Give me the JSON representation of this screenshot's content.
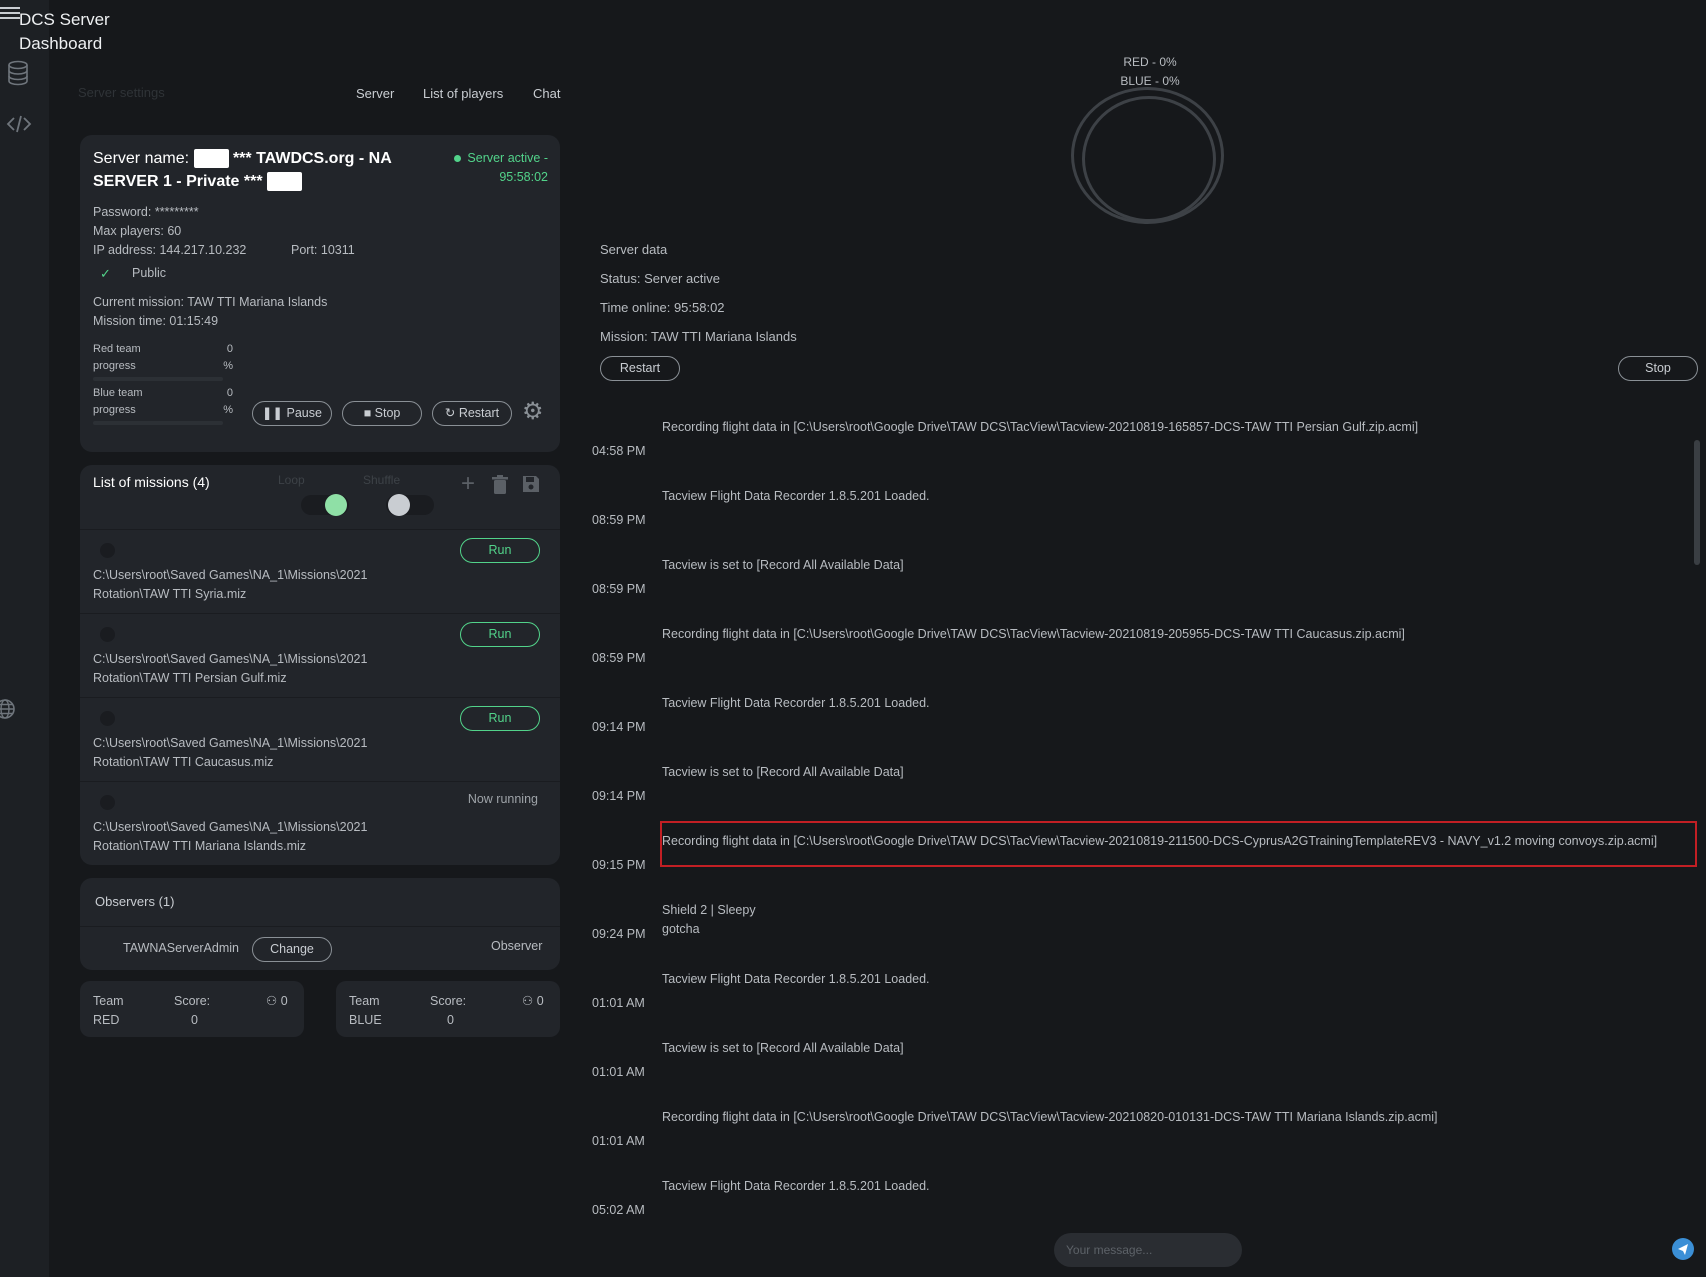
{
  "app": {
    "title": "DCS Server Dashboard"
  },
  "nav": {
    "breadcrumb": "Server settings",
    "links": [
      "Server",
      "List of players",
      "Chat"
    ]
  },
  "server": {
    "name_prefix": "Server name:",
    "name_text": "*** TAWDCS.org - NA SERVER 1 - Private ***",
    "status": "Server active - 95:58:02",
    "password": "Password: *********",
    "max_players": "Max players: 60",
    "ip": "IP address: 144.217.10.232",
    "port": "Port: 10311",
    "public_label": "Public",
    "current_mission": "Current mission: TAW TTI Mariana Islands",
    "mission_time": "Mission time: 01:15:49",
    "red_progress_label": "Red team progress",
    "red_progress_value": "0 %",
    "red_progress_fraction": 0,
    "blue_progress_label": "Blue team progress",
    "blue_progress_value": "0 %",
    "blue_progress_fraction": 0,
    "buttons": {
      "pause": "Pause",
      "stop": "Stop",
      "restart": "Restart"
    }
  },
  "missions": {
    "title": "List of missions (4)",
    "loop_label": "Loop",
    "loop_on": true,
    "shuffle_label": "Shuffle",
    "shuffle_on": false,
    "items": [
      {
        "path": "C:\\Users\\root\\Saved Games\\NA_1\\Missions\\2021 Rotation\\TAW TTI Syria.miz",
        "action": "Run"
      },
      {
        "path": "C:\\Users\\root\\Saved Games\\NA_1\\Missions\\2021 Rotation\\TAW TTI Persian Gulf.miz",
        "action": "Run"
      },
      {
        "path": "C:\\Users\\root\\Saved Games\\NA_1\\Missions\\2021 Rotation\\TAW TTI Caucasus.miz",
        "action": "Run"
      },
      {
        "path": "C:\\Users\\root\\Saved Games\\NA_1\\Missions\\2021 Rotation\\TAW TTI Mariana Islands.miz",
        "action": "Now running"
      }
    ]
  },
  "observers": {
    "title": "Observers (1)",
    "name": "TAWNAServerAdmin",
    "change_label": "Change",
    "role": "Observer"
  },
  "teams": [
    {
      "team_label": "Team",
      "team_name": "RED",
      "score_label": "Score:",
      "score": "0",
      "players": "0"
    },
    {
      "team_label": "Team",
      "team_name": "BLUE",
      "score_label": "Score:",
      "score": "0",
      "players": "0"
    }
  ],
  "ring": {
    "red": "RED - 0%",
    "blue": "BLUE - 0%"
  },
  "server_data": {
    "title": "Server data",
    "status": "Status: Server active",
    "time_online": "Time online: 95:58:02",
    "mission": "Mission: TAW TTI Mariana Islands",
    "restart_label": "Restart",
    "stop_label": "Stop"
  },
  "log": [
    {
      "msg": "Recording flight data in [C:\\Users\\root\\Google Drive\\TAW DCS\\TacView\\Tacview-20210819-165857-DCS-TAW TTI Persian Gulf.zip.acmi]",
      "time": "04:58 PM"
    },
    {
      "msg": "Tacview Flight Data Recorder 1.8.5.201 Loaded.",
      "time": "08:59 PM"
    },
    {
      "msg": "Tacview is set to [Record All Available Data]",
      "time": "08:59 PM"
    },
    {
      "msg": "Recording flight data in [C:\\Users\\root\\Google Drive\\TAW DCS\\TacView\\Tacview-20210819-205955-DCS-TAW TTI Caucasus.zip.acmi]",
      "time": "08:59 PM"
    },
    {
      "msg": "Tacview Flight Data Recorder 1.8.5.201 Loaded.",
      "time": "09:14 PM"
    },
    {
      "msg": "Tacview is set to [Record All Available Data]",
      "time": "09:14 PM"
    },
    {
      "msg": "Recording flight data in [C:\\Users\\root\\Google Drive\\TAW DCS\\TacView\\Tacview-20210819-211500-DCS-CyprusA2GTrainingTemplateREV3 - NAVY_v1.2 moving convoys.zip.acmi]",
      "time": "09:15 PM"
    },
    {
      "msg": "Shield 2 | Sleepy",
      "msg2": "gotcha",
      "time": "09:24 PM"
    },
    {
      "msg": "Tacview Flight Data Recorder 1.8.5.201 Loaded.",
      "time": "01:01 AM"
    },
    {
      "msg": "Tacview is set to [Record All Available Data]",
      "time": "01:01 AM"
    },
    {
      "msg": "Recording flight data in [C:\\Users\\root\\Google Drive\\TAW DCS\\TacView\\Tacview-20210820-010131-DCS-TAW TTI Mariana Islands.zip.acmi]",
      "time": "01:01 AM"
    },
    {
      "msg": "Tacview Flight Data Recorder 1.8.5.201 Loaded.",
      "time": "05:02 AM"
    }
  ],
  "chat_input": {
    "placeholder": "Your message..."
  },
  "colors": {
    "accent_green": "#52d38a",
    "highlight_red": "#c21f24",
    "send_blue": "#3b8fd6"
  }
}
